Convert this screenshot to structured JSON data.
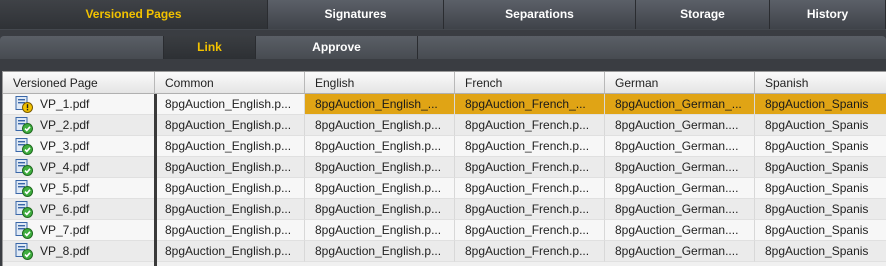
{
  "tabs": [
    "Versioned Pages",
    "Signatures",
    "Separations",
    "Storage",
    "History"
  ],
  "subtabs": [
    "Link",
    "Approve"
  ],
  "columns": [
    "Versioned Page",
    "Common",
    "English",
    "French",
    "German",
    "Spanish"
  ],
  "rows": [
    {
      "name": "VP_1.pdf",
      "status": "warning",
      "common": "8pgAuction_English.p...",
      "english": "8pgAuction_English_...",
      "french": "8pgAuction_French_...",
      "german": "8pgAuction_German_...",
      "spanish": "8pgAuction_Spanis"
    },
    {
      "name": "VP_2.pdf",
      "status": "ok",
      "common": "8pgAuction_English.p...",
      "english": "8pgAuction_English.p...",
      "french": "8pgAuction_French.p...",
      "german": "8pgAuction_German....",
      "spanish": "8pgAuction_Spanis"
    },
    {
      "name": "VP_3.pdf",
      "status": "ok",
      "common": "8pgAuction_English.p...",
      "english": "8pgAuction_English.p...",
      "french": "8pgAuction_French.p...",
      "german": "8pgAuction_German....",
      "spanish": "8pgAuction_Spanis"
    },
    {
      "name": "VP_4.pdf",
      "status": "ok",
      "common": "8pgAuction_English.p...",
      "english": "8pgAuction_English.p...",
      "french": "8pgAuction_French.p...",
      "german": "8pgAuction_German....",
      "spanish": "8pgAuction_Spanis"
    },
    {
      "name": "VP_5.pdf",
      "status": "ok",
      "common": "8pgAuction_English.p...",
      "english": "8pgAuction_English.p...",
      "french": "8pgAuction_French.p...",
      "german": "8pgAuction_German....",
      "spanish": "8pgAuction_Spanis"
    },
    {
      "name": "VP_6.pdf",
      "status": "ok",
      "common": "8pgAuction_English.p...",
      "english": "8pgAuction_English.p...",
      "french": "8pgAuction_French.p...",
      "german": "8pgAuction_German....",
      "spanish": "8pgAuction_Spanis"
    },
    {
      "name": "VP_7.pdf",
      "status": "ok",
      "common": "8pgAuction_English.p...",
      "english": "8pgAuction_English.p...",
      "french": "8pgAuction_French.p...",
      "german": "8pgAuction_German....",
      "spanish": "8pgAuction_Spanis"
    },
    {
      "name": "VP_8.pdf",
      "status": "ok",
      "common": "8pgAuction_English.p...",
      "english": "8pgAuction_English.p...",
      "french": "8pgAuction_French.p...",
      "german": "8pgAuction_German....",
      "spanish": "8pgAuction_Spanis"
    }
  ],
  "icons": {
    "ok": "page-check-icon",
    "warning": "page-warning-icon"
  },
  "colors": {
    "accent": "#f2c200",
    "highlight": "#e0a415"
  }
}
